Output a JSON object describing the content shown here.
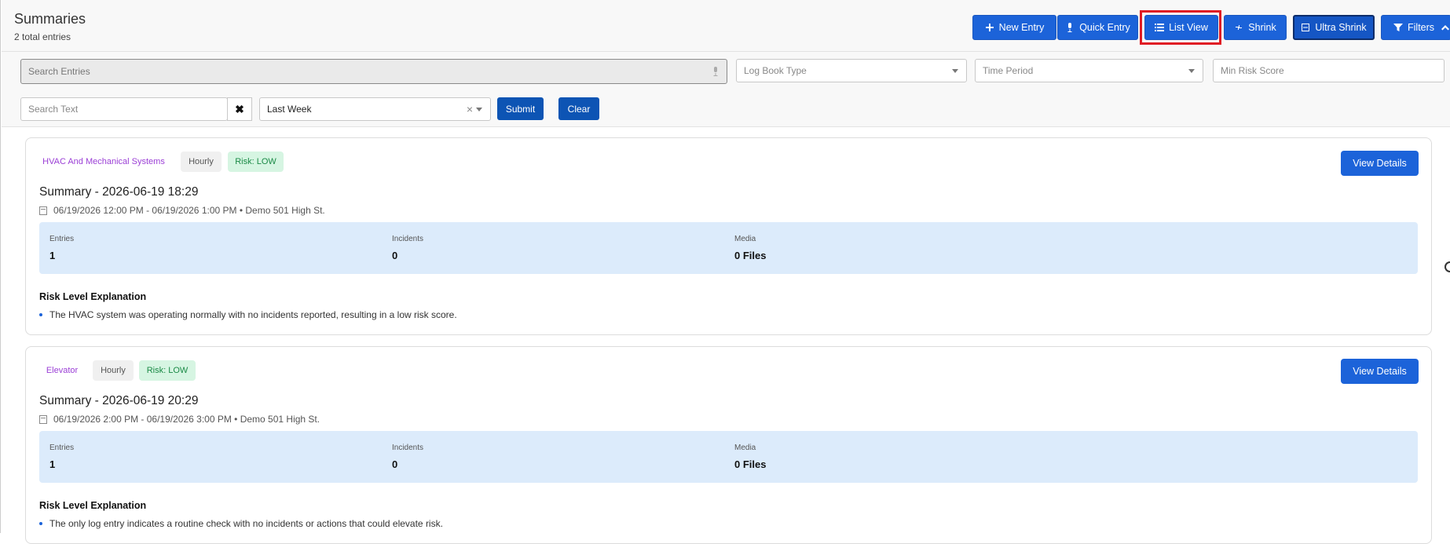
{
  "header": {
    "title": "Summaries",
    "subtitle": "2 total entries",
    "buttons": {
      "new_entry": "New Entry",
      "quick_entry": "Quick Entry",
      "list_view": "List View",
      "shrink": "Shrink",
      "ultra_shrink": "Ultra Shrink",
      "filters": "Filters"
    }
  },
  "filters": {
    "search_entries_placeholder": "Search Entries",
    "log_book_type_placeholder": "Log Book Type",
    "time_period_placeholder": "Time Period",
    "min_risk_score_placeholder": "Min Risk Score",
    "search_text_placeholder": "Search Text",
    "clear_x": "✖",
    "period_value": "Last Week",
    "period_clear": "×",
    "submit": "Submit",
    "clear": "Clear"
  },
  "summaries": [
    {
      "category": "HVAC And Mechanical Systems",
      "frequency": "Hourly",
      "risk": "Risk: LOW",
      "view_details": "View Details",
      "title": "Summary - 2026-06-19 18:29",
      "meta": "06/19/2026 12:00 PM - 06/19/2026 1:00 PM • Demo 501 High St.",
      "stats": [
        {
          "label": "Entries",
          "value": "1"
        },
        {
          "label": "Incidents",
          "value": "0"
        },
        {
          "label": "Media",
          "value": "0 Files"
        }
      ],
      "risk_heading": "Risk Level Explanation",
      "risk_explanation": "The HVAC system was operating normally with no incidents reported, resulting in a low risk score."
    },
    {
      "category": "Elevator",
      "frequency": "Hourly",
      "risk": "Risk: LOW",
      "view_details": "View Details",
      "title": "Summary - 2026-06-19 20:29",
      "meta": "06/19/2026 2:00 PM - 06/19/2026 3:00 PM • Demo 501 High St.",
      "stats": [
        {
          "label": "Entries",
          "value": "1"
        },
        {
          "label": "Incidents",
          "value": "0"
        },
        {
          "label": "Media",
          "value": "0 Files"
        }
      ],
      "risk_heading": "Risk Level Explanation",
      "risk_explanation": "The only log entry indicates a routine check with no incidents or actions that could elevate risk."
    }
  ],
  "colors": {
    "primary": "#1c63d9",
    "category": "#9b3fd6",
    "risk_low_text": "#1b8a46",
    "risk_low_bg": "#d6f5e2",
    "stats_bg": "#dcebfb",
    "highlight": "#e01b24"
  }
}
